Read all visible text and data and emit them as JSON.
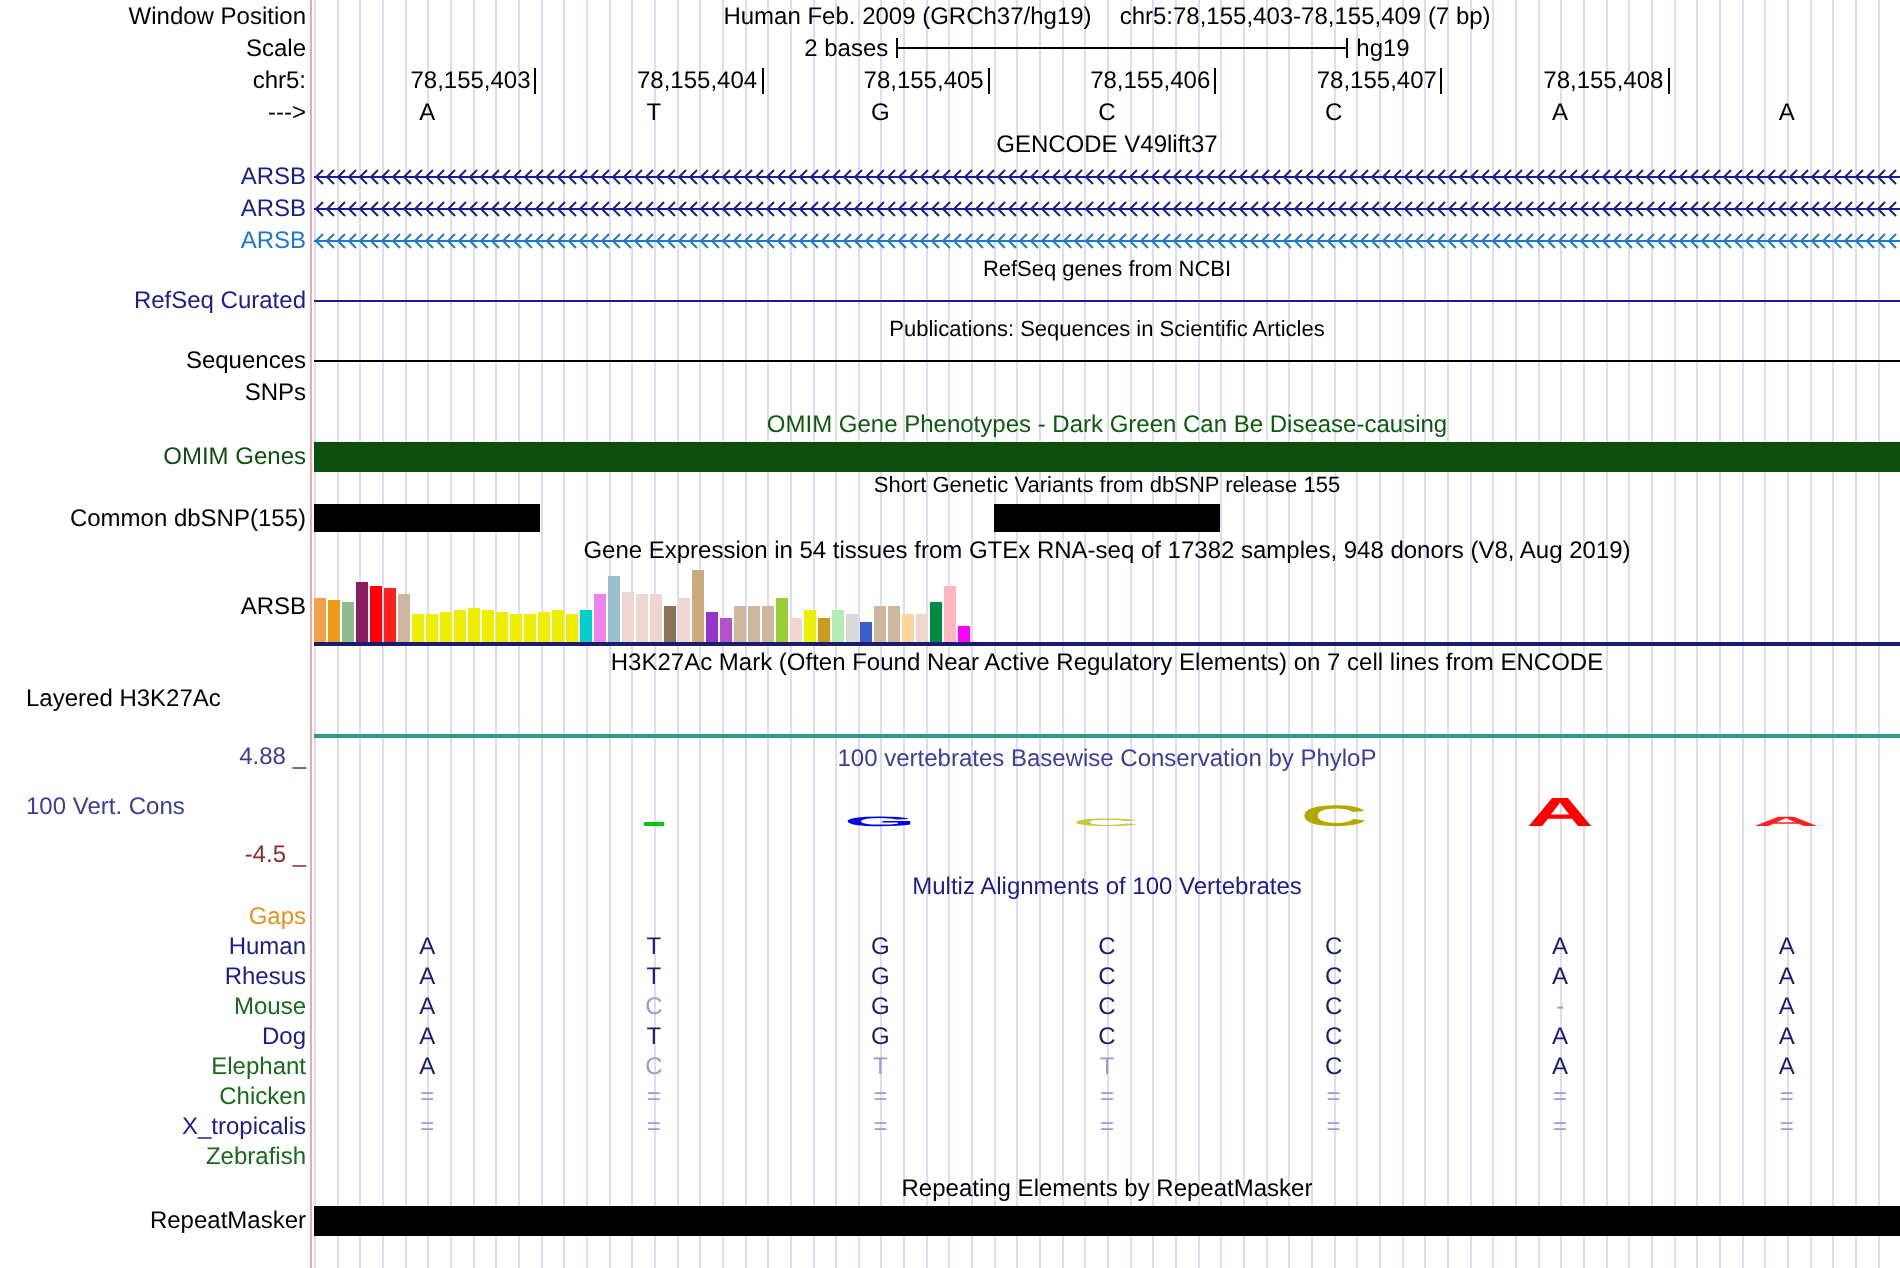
{
  "position": {
    "label": "Window Position",
    "assembly": "Human Feb. 2009 (GRCh37/hg19)",
    "range": "chr5:78,155,403-78,155,409 (7 bp)"
  },
  "scale": {
    "label": "Scale",
    "span": "2 bases",
    "db": "hg19"
  },
  "ruler": {
    "label": "chr5:",
    "ticks": [
      "78,155,403",
      "78,155,404",
      "78,155,405",
      "78,155,406",
      "78,155,407",
      "78,155,408"
    ]
  },
  "sequence": {
    "label": "--->",
    "bases": [
      "A",
      "T",
      "G",
      "C",
      "C",
      "A",
      "A"
    ]
  },
  "tracks": [
    {
      "kind": "gene",
      "title": "GENCODE V49lift37",
      "genes": [
        {
          "label": "ARSB",
          "color": "#1c1c8c"
        },
        {
          "label": "ARSB",
          "color": "#1c1c8c"
        },
        {
          "label": "ARSB",
          "color": "#1e78c8"
        }
      ]
    },
    {
      "kind": "line",
      "title": "RefSeq genes from NCBI",
      "color": "#1c1c8c",
      "rows": [
        {
          "label": "RefSeq Curated",
          "line": true
        }
      ]
    },
    {
      "kind": "line",
      "title": "Publications: Sequences in Scientific Articles",
      "color": "#000000",
      "rows": [
        {
          "label": "Sequences",
          "line": true
        },
        {
          "label": "SNPs",
          "line": false
        }
      ]
    },
    {
      "kind": "bar",
      "title": {
        "text": "OMIM Gene Phenotypes - Dark Green Can Be Disease-causing",
        "color": "#0c5a0c"
      },
      "label": "OMIM Genes",
      "color": "#0c4e0c"
    },
    {
      "kind": "snp",
      "title": "Short Genetic Variants from dbSNP release 155",
      "label": "Common dbSNP(155)",
      "variants": [
        true,
        false,
        false,
        true,
        false,
        false,
        false
      ]
    },
    {
      "kind": "expression",
      "title": "Gene Expression in 54 tissues from GTEx RNA-seq of 17382 samples, 948 donors (V8, Aug 2019)",
      "label": "ARSB"
    },
    {
      "kind": "signal",
      "title": "H3K27Ac Mark (Often Found Near Active Regulatory Elements) on 7 cell lines from ENCODE",
      "label": "Layered H3K27Ac"
    },
    {
      "kind": "phylop",
      "title": {
        "text": "100 vertebrates Basewise Conservation by PhyloP",
        "color": "#3c3c9c"
      },
      "label": "100 Vert. Cons",
      "max": "4.88 _",
      "min": "-4.5 _",
      "logo": [
        {
          "kind": "mark",
          "color": "#00c800"
        },
        {
          "kind": "letter",
          "letter": "G",
          "color": "#0000e6"
        },
        {
          "kind": "letter",
          "letter": "C",
          "color": "#c8c83c"
        },
        {
          "kind": "letter",
          "letter": "C",
          "color": "#b4a800"
        },
        {
          "kind": "letter",
          "letter": "A",
          "color": "#ff0000"
        },
        {
          "kind": "letter",
          "letter": "A",
          "color": "#ff2020"
        }
      ]
    },
    {
      "kind": "multiz",
      "title": {
        "text": "Multiz Alignments of 100 Vertebrates",
        "color": "#1c1c8c"
      },
      "gaps_label": "Gaps",
      "species": [
        {
          "name": "Human",
          "color": "#1c1c8c",
          "bases": [
            {
              "text": "A",
              "faded": false
            },
            {
              "text": "T",
              "faded": false
            },
            {
              "text": "G",
              "faded": false
            },
            {
              "text": "C",
              "faded": false
            },
            {
              "text": "C",
              "faded": false
            },
            {
              "text": "A",
              "faded": false
            },
            {
              "text": "A",
              "faded": false
            }
          ]
        },
        {
          "name": "Rhesus",
          "color": "#1c1c8c",
          "bases": [
            {
              "text": "A",
              "faded": false
            },
            {
              "text": "T",
              "faded": false
            },
            {
              "text": "G",
              "faded": false
            },
            {
              "text": "C",
              "faded": false
            },
            {
              "text": "C",
              "faded": false
            },
            {
              "text": "A",
              "faded": false
            },
            {
              "text": "A",
              "faded": false
            }
          ]
        },
        {
          "name": "Mouse",
          "color": "#186a18",
          "bases": [
            {
              "text": "A",
              "faded": false
            },
            {
              "text": "C",
              "faded": true
            },
            {
              "text": "G",
              "faded": false
            },
            {
              "text": "C",
              "faded": false
            },
            {
              "text": "C",
              "faded": false
            },
            {
              "text": "-",
              "faded": true
            },
            {
              "text": "A",
              "faded": false
            }
          ]
        },
        {
          "name": "Dog",
          "color": "#1c1c8c",
          "bases": [
            {
              "text": "A",
              "faded": false
            },
            {
              "text": "T",
              "faded": false
            },
            {
              "text": "G",
              "faded": false
            },
            {
              "text": "C",
              "faded": false
            },
            {
              "text": "C",
              "faded": false
            },
            {
              "text": "A",
              "faded": false
            },
            {
              "text": "A",
              "faded": false
            }
          ]
        },
        {
          "name": "Elephant",
          "color": "#186a18",
          "bases": [
            {
              "text": "A",
              "faded": false
            },
            {
              "text": "C",
              "faded": true
            },
            {
              "text": "T",
              "faded": true
            },
            {
              "text": "T",
              "faded": true
            },
            {
              "text": "C",
              "faded": false
            },
            {
              "text": "A",
              "faded": false
            },
            {
              "text": "A",
              "faded": false
            }
          ]
        },
        {
          "name": "Chicken",
          "color": "#186a18",
          "bases": [
            {
              "text": "=",
              "faded": true
            },
            {
              "text": "=",
              "faded": true
            },
            {
              "text": "=",
              "faded": true
            },
            {
              "text": "=",
              "faded": true
            },
            {
              "text": "=",
              "faded": true
            },
            {
              "text": "=",
              "faded": true
            },
            {
              "text": "=",
              "faded": true
            }
          ]
        },
        {
          "name": "X_tropicalis",
          "color": "#1c1c8c",
          "bases": [
            {
              "text": "=",
              "faded": true
            },
            {
              "text": "=",
              "faded": true
            },
            {
              "text": "=",
              "faded": true
            },
            {
              "text": "=",
              "faded": true
            },
            {
              "text": "=",
              "faded": true
            },
            {
              "text": "=",
              "faded": true
            },
            {
              "text": "=",
              "faded": true
            }
          ]
        },
        {
          "name": "Zebrafish",
          "color": "#186a18"
        }
      ]
    },
    {
      "kind": "bar",
      "title": "Repeating Elements by RepeatMasker",
      "label": "RepeatMasker",
      "color": "#000000"
    }
  ]
}
